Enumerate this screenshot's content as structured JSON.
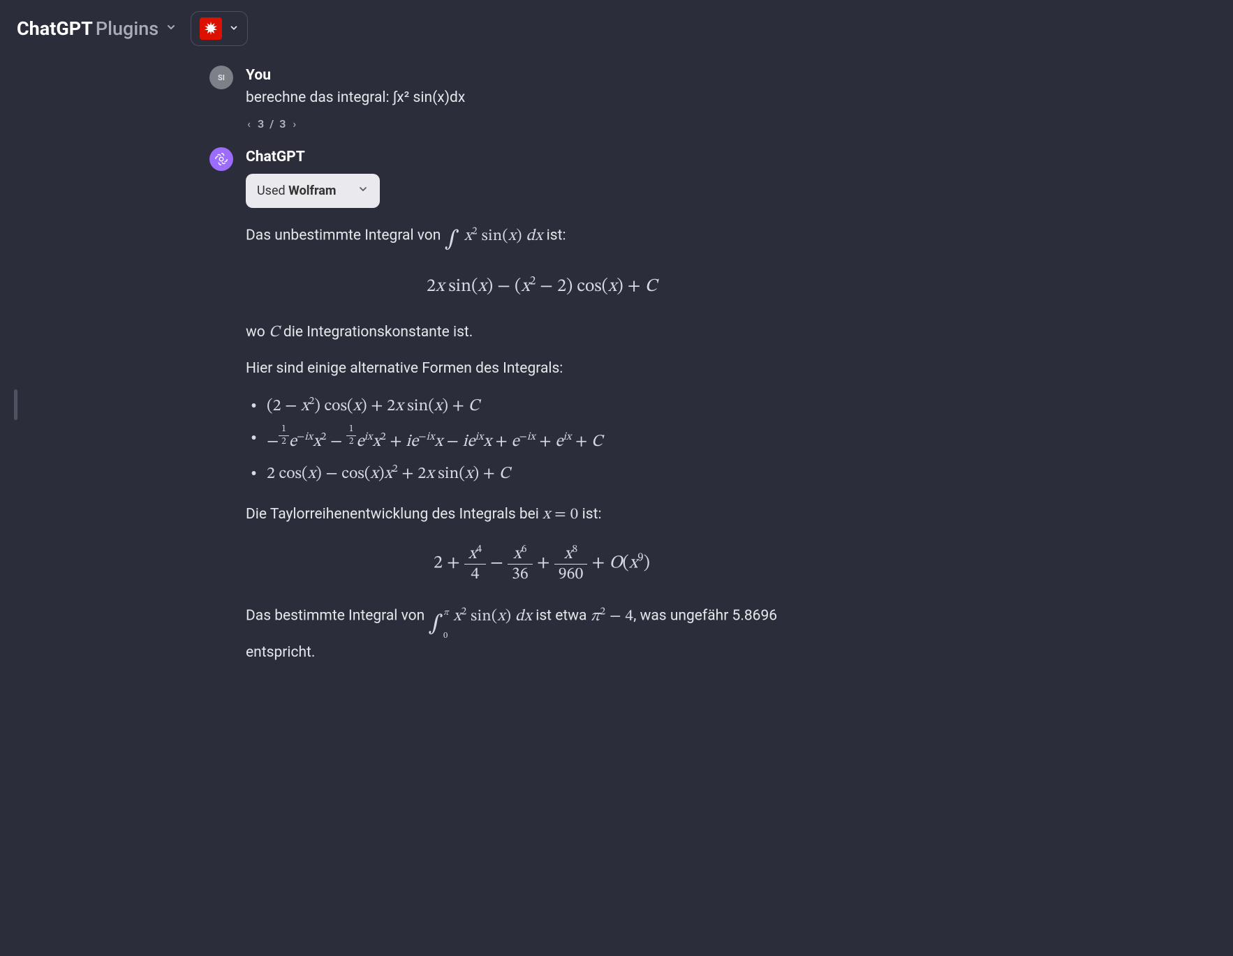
{
  "header": {
    "title_main": "ChatGPT",
    "title_sub": "Plugins",
    "plugin_name": "Wolfram"
  },
  "user_msg": {
    "author": "You",
    "avatar_initials": "SI",
    "text": "berechne das integral: ∫x² sin(x)dx",
    "pagination_current": "3",
    "pagination_total": "3"
  },
  "gpt_msg": {
    "author": "ChatGPT",
    "used_prefix": "Used ",
    "used_plugin": "Wolfram",
    "p1_pre": "Das unbestimmte Integral von ",
    "p1_eq_html": "<span class=\"int-sym\">∫</span> x<span class=\"sup\">2</span> <span class=\"rm\">sin(</span>x<span class=\"rm\">)</span> dx",
    "p1_post": " ist:",
    "eq_block1_html": "2<i>x</i> sin(<i>x</i>) − (<i>x</i><span class=\"sup\">2</span> − 2) cos(<i>x</i>) + <i>C</i>",
    "p2_pre": "wo ",
    "p2_eq_html": "C",
    "p2_post": " die Integrationskonstante ist.",
    "p3": "Hier sind einige alternative Formen des Integrals:",
    "alt_forms": [
      "(2 − <i>x</i><span class=\"sup\">2</span>) cos(<i>x</i>) + 2<i>x</i> sin(<i>x</i>) + <i>C</i>",
      "−<span class=\"frac frac-s\"><span class=\"num\">1</span><span class=\"den\">2</span></span><i>e</i><span class=\"sup\">−<i>ix</i></span><i>x</i><span class=\"sup\">2</span> − <span class=\"frac frac-s\"><span class=\"num\">1</span><span class=\"den\">2</span></span><i>e</i><span class=\"sup\"><i>ix</i></span><i>x</i><span class=\"sup\">2</span> + <i>ie</i><span class=\"sup\">−<i>ix</i></span><i>x</i> − <i>ie</i><span class=\"sup\"><i>ix</i></span><i>x</i> + <i>e</i><span class=\"sup\">−<i>ix</i></span> + <i>e</i><span class=\"sup\"><i>ix</i></span> + <i>C</i>",
      "2 cos(<i>x</i>) − cos(<i>x</i>)<i>x</i><span class=\"sup\">2</span> + 2<i>x</i> sin(<i>x</i>) + <i>C</i>"
    ],
    "p4_pre": "Die Taylorreihenentwicklung des Integrals bei ",
    "p4_eq_html": "x <span class=\"rm\">= 0</span>",
    "p4_post": " ist:",
    "eq_block2_html": "2 + <span class=\"frac frac-big\"><span class=\"num\"><i>x</i><span class=\"sup\">4</span></span><span class=\"den\">4</span></span> − <span class=\"frac frac-big\"><span class=\"num\"><i>x</i><span class=\"sup\">6</span></span><span class=\"den\">36</span></span> + <span class=\"frac frac-big\"><span class=\"num\"><i>x</i><span class=\"sup\">8</span></span><span class=\"den\">960</span></span> + <i>O</i>(<i>x</i><span class=\"sup\">9</span>)",
    "p5_pre": "Das bestimmte Integral von ",
    "p5_eq_html": "<span class=\"int-bounds\"><span class=\"int-sym\">∫</span><span class=\"ub\">π</span><span class=\"lb\">0</span></span>&nbsp; x<span class=\"sup\">2</span> <span class=\"rm\">sin(</span>x<span class=\"rm\">)</span> dx",
    "p5_mid": " ist etwa ",
    "p5_eq2_html": "π<span class=\"sup rm\">2</span> <span class=\"rm\">− 4</span>",
    "p5_post": ", was ungefähr 5.8696 entspricht."
  }
}
